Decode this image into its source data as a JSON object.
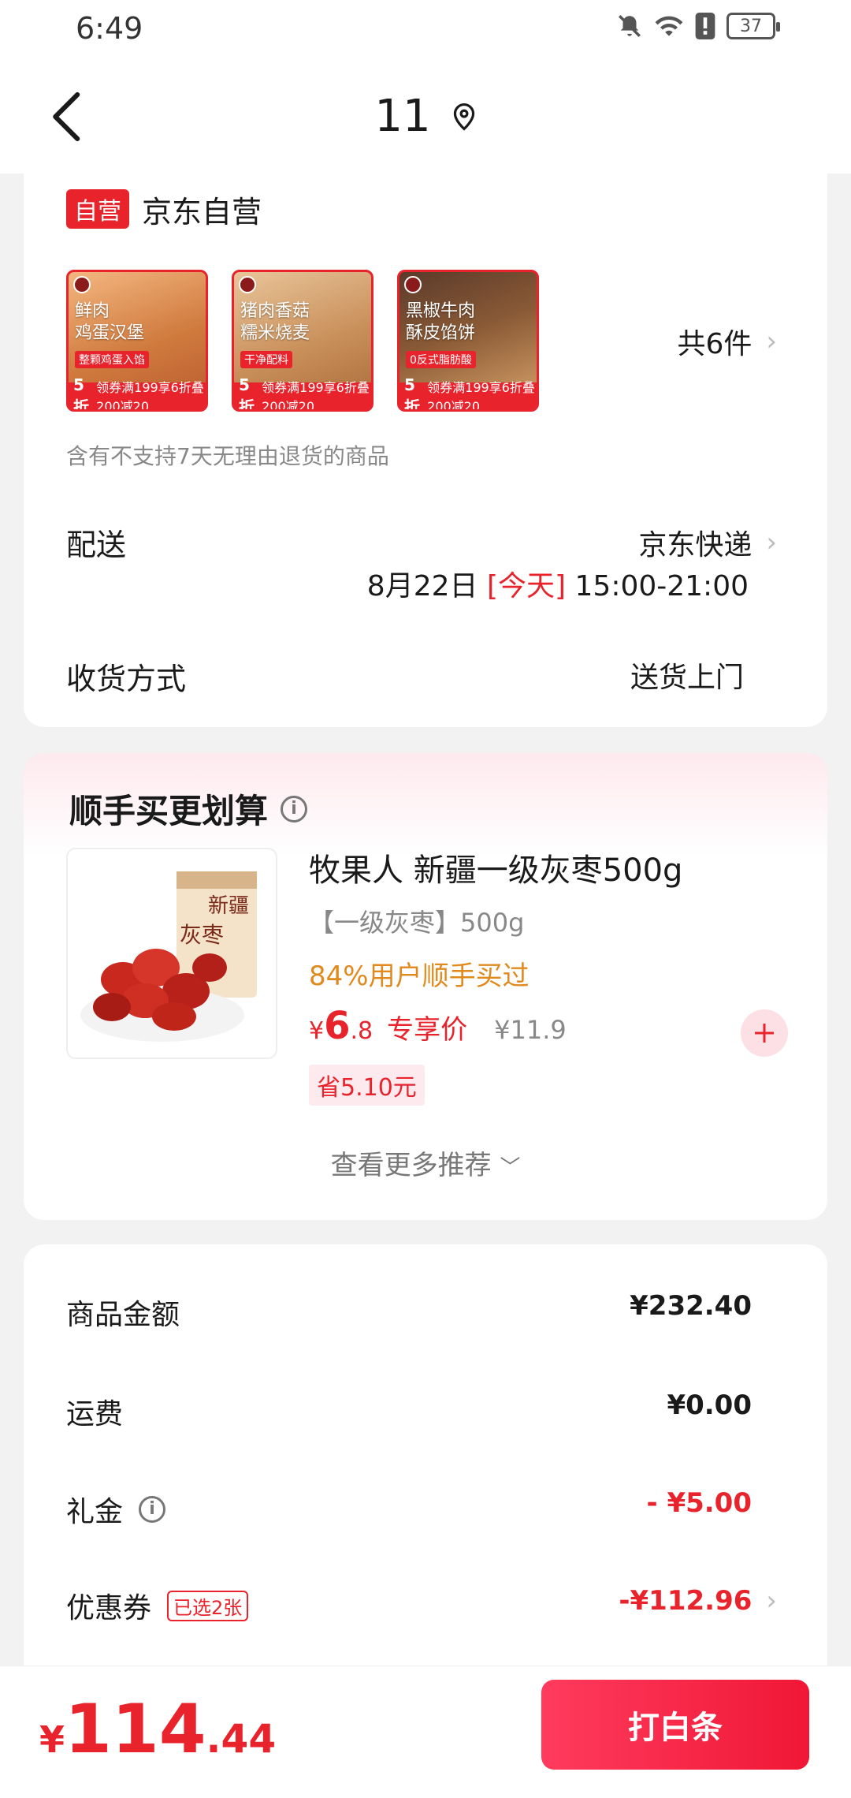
{
  "status_bar": {
    "time": "6:49",
    "battery": "37"
  },
  "header": {
    "title": "11"
  },
  "store": {
    "badge": "自营",
    "name": "京东自营",
    "thumbnails": [
      {
        "title_line1": "鲜肉",
        "title_line2": "鸡蛋汉堡",
        "tag": "整颗鸡蛋入馅",
        "bar_big": "5折",
        "bar_text": "领券满199享6折叠200减20"
      },
      {
        "title_line1": "猪肉香菇",
        "title_line2": "糯米烧麦",
        "tag": "干净配料",
        "bar_big": "5折",
        "bar_text": "领券满199享6折叠200减20"
      },
      {
        "title_line1": "黑椒牛肉",
        "title_line2": "酥皮馅饼",
        "tag": "0反式脂肪酸",
        "bar_big": "5折",
        "bar_text": "领券满199享6折叠200减20"
      }
    ],
    "item_count": "共6件",
    "notice": "含有不支持7天无理由退货的商品"
  },
  "delivery": {
    "label": "配送",
    "carrier": "京东快递",
    "date": "8月22日",
    "today": "[今天]",
    "time_range": "15:00-21:00"
  },
  "receive": {
    "label": "收货方式",
    "value": "送货上门"
  },
  "recommend": {
    "title": "顺手买更划算",
    "product": {
      "name": "牧果人 新疆一级灰枣500g",
      "spec": "【一级灰枣】500g",
      "buy_rate": "84%用户顺手买过",
      "price_yen": "¥",
      "price_int": "6",
      "price_dec": ".8",
      "exclusive": "专享价",
      "original": "¥11.9",
      "save": "省5.10元",
      "pkg_text1": "新疆",
      "pkg_text2": "灰枣"
    },
    "more": "查看更多推荐"
  },
  "summary": {
    "goods_label": "商品金额",
    "goods_value": "¥232.40",
    "freight_label": "运费",
    "freight_value": "¥0.00",
    "gift_label": "礼金",
    "gift_value": "- ¥5.00",
    "coupon_label": "优惠券",
    "coupon_tag": "已选2张",
    "coupon_value": "-¥112.96"
  },
  "bottom": {
    "total_yen": "¥",
    "total_int": "114",
    "total_dec": ".44",
    "pay_button": "打白条"
  },
  "colors": {
    "accent": "#e8232c",
    "orange": "#e08a1e"
  }
}
